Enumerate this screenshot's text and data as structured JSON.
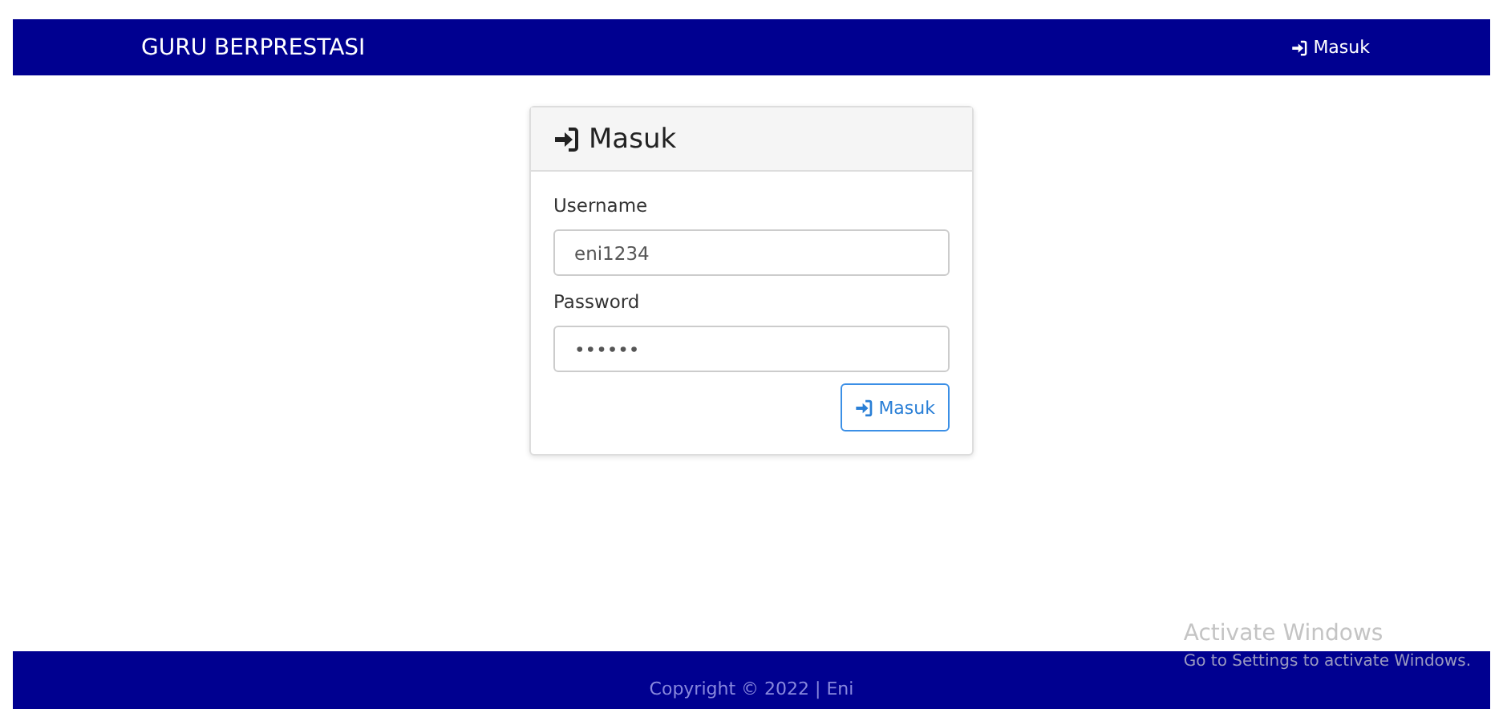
{
  "navbar": {
    "brand": "GURU BERPRESTASI",
    "login_link": "Masuk"
  },
  "login_card": {
    "title": "Masuk",
    "fields": [
      {
        "label": "Username",
        "value": "eni1234"
      },
      {
        "label": "Password",
        "value": "••••••"
      }
    ],
    "submit_button": "Masuk"
  },
  "footer": {
    "text": "Copyright © 2022 | Eni"
  },
  "os_overlay": {
    "title": "Activate Windows",
    "subtitle": "Go to Settings to activate Windows."
  }
}
